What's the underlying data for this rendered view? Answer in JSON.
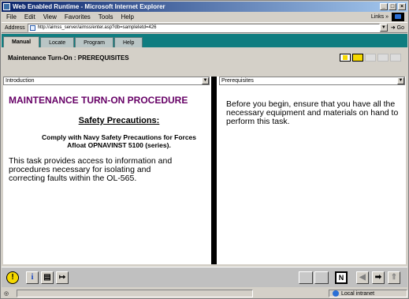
{
  "window": {
    "title": "Web Enabled Runtime - Microsoft Internet Explorer"
  },
  "menu": {
    "items": [
      "File",
      "Edit",
      "View",
      "Favorites",
      "Tools",
      "Help"
    ],
    "links": "Links »"
  },
  "address": {
    "label": "Address",
    "url": "http://aimss_server/aimss/enter.asp?db=sampleIetd=426",
    "go": "Go"
  },
  "tabs": [
    {
      "label": "Manual",
      "active": true
    },
    {
      "label": "Locate",
      "active": false
    },
    {
      "label": "Program",
      "active": false
    },
    {
      "label": "Help",
      "active": false
    }
  ],
  "page": {
    "title": "Maintenance Turn-On : PREREQUISITES"
  },
  "left_pane": {
    "selector": "Introduction",
    "proc_title": "MAINTENANCE TURN-ON PROCEDURE",
    "safety_heading": "Safety Precautions:",
    "safety_text": "Comply with Navy Safety Precautions for Forces Afloat OPNAVINST 5100 (series).",
    "description": "This task provides access to information and procedures necessary for isolating and correcting faults within the OL-565."
  },
  "right_pane": {
    "selector": "Prerequisites",
    "text": "Before you begin, ensure that you have all the necessary equipment and materials on hand to perform this task."
  },
  "bottom": {
    "n_label": "N"
  },
  "status": {
    "zone": "Local intranet"
  },
  "colors": {
    "teal": "#0f7d80",
    "proc_title": "#660066",
    "accent_yellow": "#f5d800"
  }
}
